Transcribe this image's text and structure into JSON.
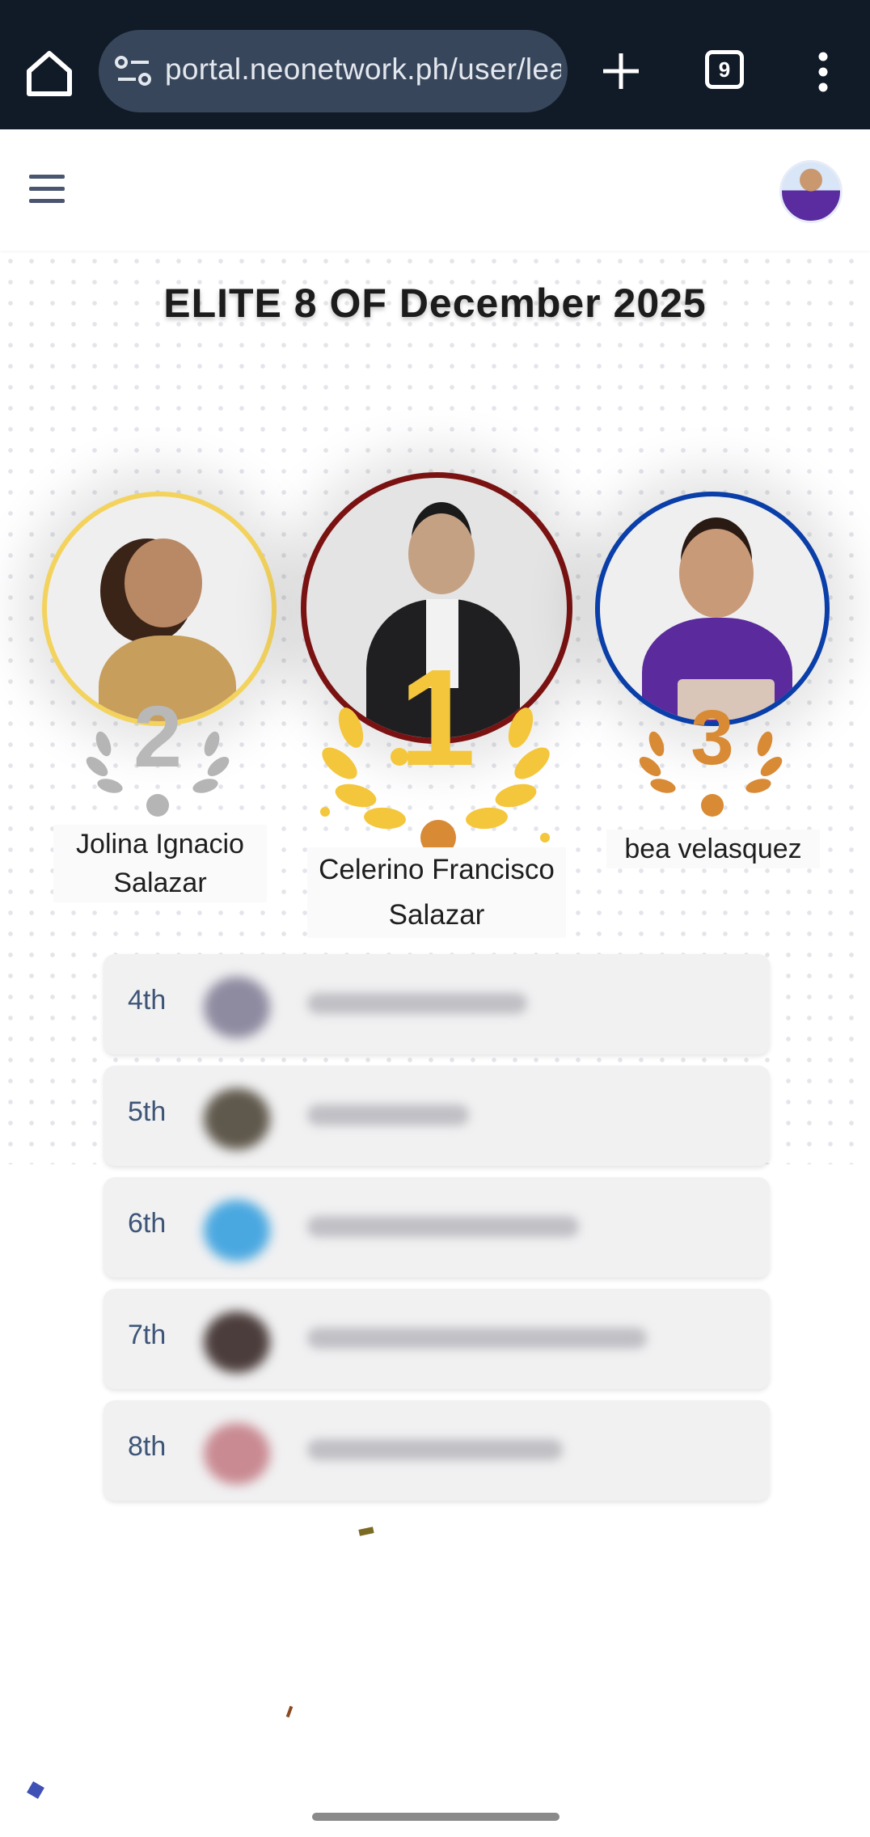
{
  "browser": {
    "url": "portal.neonetwork.ph/user/leaderboard",
    "tab_count": "9"
  },
  "leaderboard": {
    "title": "ELITE 8 OF December 2025",
    "podium": [
      {
        "rank": "1",
        "name": "Celerino Francisco Salazar",
        "ring_color": "#7a1212",
        "accent": "#f4c63b"
      },
      {
        "rank": "2",
        "name": "Jolina Ignacio Salazar",
        "ring_color": "#f3d35e",
        "accent": "#b5b5b5"
      },
      {
        "rank": "3",
        "name": "bea velasquez",
        "ring_color": "#0a3ea8",
        "accent": "#d88a35"
      }
    ],
    "list": [
      {
        "rank": "4th"
      },
      {
        "rank": "5th"
      },
      {
        "rank": "6th"
      },
      {
        "rank": "7th"
      },
      {
        "rank": "8th"
      }
    ]
  }
}
